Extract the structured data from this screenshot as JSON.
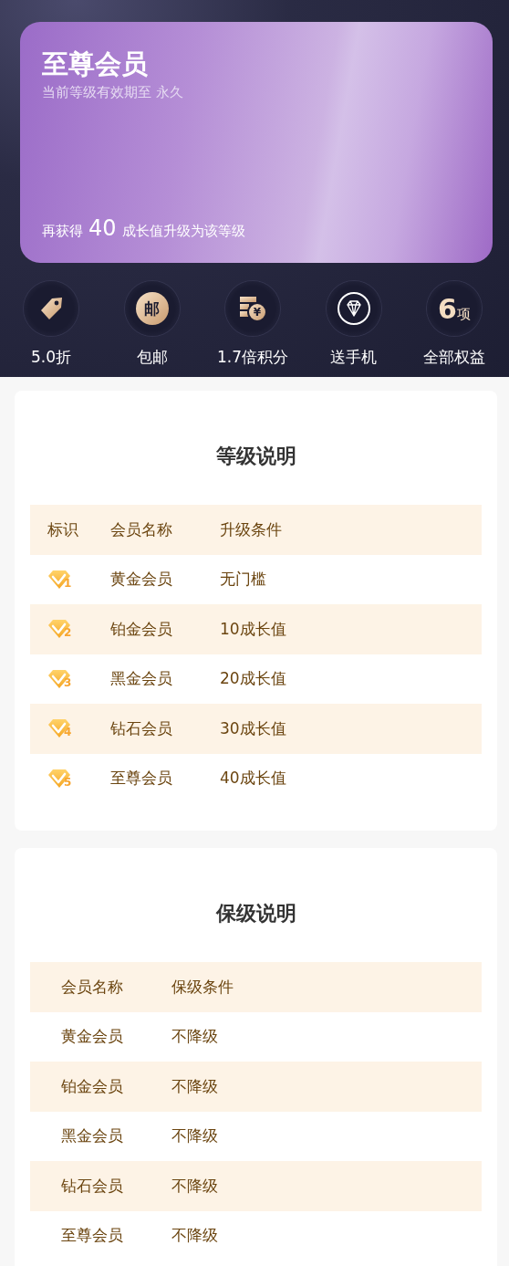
{
  "member_card": {
    "title": "至尊会员",
    "validity": "当前等级有效期至 永久",
    "upgrade_prefix": "再获得",
    "upgrade_value": "40",
    "upgrade_suffix": "成长值升级为该等级"
  },
  "benefits": [
    {
      "kind": "tag",
      "label": "5.0折"
    },
    {
      "kind": "post",
      "glyph": "邮",
      "label": "包邮"
    },
    {
      "kind": "coins",
      "glyph": "¥",
      "label": "1.7倍积分"
    },
    {
      "kind": "diamond",
      "label": "送手机"
    },
    {
      "kind": "count",
      "number": "6",
      "unit": "项",
      "label": "全部权益"
    }
  ],
  "level_table": {
    "title": "等级说明",
    "columns": [
      "标识",
      "会员名称",
      "升级条件"
    ],
    "rows": [
      {
        "badge": "1",
        "name": "黄金会员",
        "condition": "无门槛"
      },
      {
        "badge": "2",
        "name": "铂金会员",
        "condition": "10成长值"
      },
      {
        "badge": "3",
        "name": "黑金会员",
        "condition": "20成长值"
      },
      {
        "badge": "4",
        "name": "钻石会员",
        "condition": "30成长值"
      },
      {
        "badge": "5",
        "name": "至尊会员",
        "condition": "40成长值"
      }
    ]
  },
  "keep_table": {
    "title": "保级说明",
    "columns": [
      "会员名称",
      "保级条件"
    ],
    "rows": [
      {
        "name": "黄金会员",
        "condition": "不降级"
      },
      {
        "name": "铂金会员",
        "condition": "不降级"
      },
      {
        "name": "黑金会员",
        "condition": "不降级"
      },
      {
        "name": "钻石会员",
        "condition": "不降级"
      },
      {
        "name": "至尊会员",
        "condition": "不降级"
      }
    ]
  }
}
